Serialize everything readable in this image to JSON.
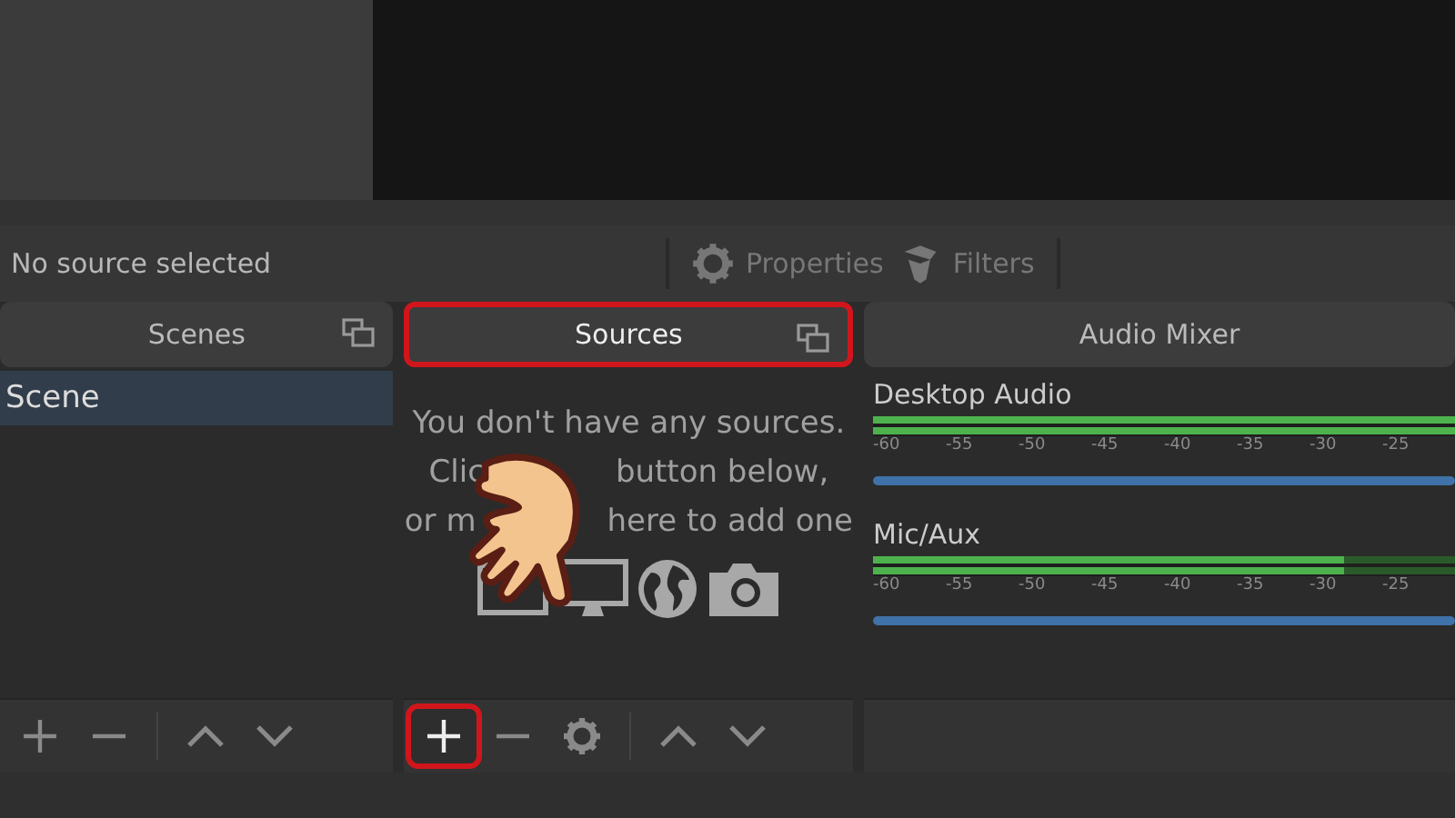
{
  "properties_bar": {
    "status": "No source selected",
    "buttons": [
      {
        "label": "Properties",
        "kind": "gear"
      },
      {
        "label": "Filters",
        "kind": "filter"
      }
    ]
  },
  "scenes": {
    "title": "Scenes",
    "highlighted": false,
    "items": [
      {
        "label": "Scene",
        "selected": true
      }
    ]
  },
  "sources": {
    "title": "Sources",
    "highlighted": true,
    "message": [
      {
        "parts": [
          "You don't have any sources."
        ]
      },
      {
        "parts": [
          "Clic",
          "button below,"
        ]
      },
      {
        "parts": [
          "or m",
          "here to add one"
        ]
      }
    ]
  },
  "scene_toolbar": [
    {
      "kind": "add",
      "highlighted": false
    },
    {
      "kind": "remove",
      "highlighted": false
    },
    {
      "kind": "up",
      "highlighted": false
    },
    {
      "kind": "down",
      "highlighted": false
    }
  ],
  "source_toolbar": [
    {
      "kind": "add",
      "highlighted": true
    },
    {
      "kind": "remove",
      "highlighted": false
    },
    {
      "kind": "settings",
      "highlighted": false
    },
    {
      "kind": "up",
      "highlighted": false
    },
    {
      "kind": "down",
      "highlighted": false
    }
  ],
  "audio_mixer": {
    "title": "Audio Mixer",
    "channels": [
      {
        "name": "Desktop Audio",
        "level": 1,
        "scale": [
          "-60",
          "-55",
          "-50",
          "-45",
          "-40",
          "-35",
          "-30",
          "-25"
        ],
        "volume": {
          "level": 1
        }
      },
      {
        "name": "Mic/Aux",
        "level": 0.81,
        "scale": [
          "-60",
          "-55",
          "-50",
          "-45",
          "-40",
          "-35",
          "-30",
          "-25"
        ],
        "volume": {
          "level": 1
        }
      }
    ]
  }
}
